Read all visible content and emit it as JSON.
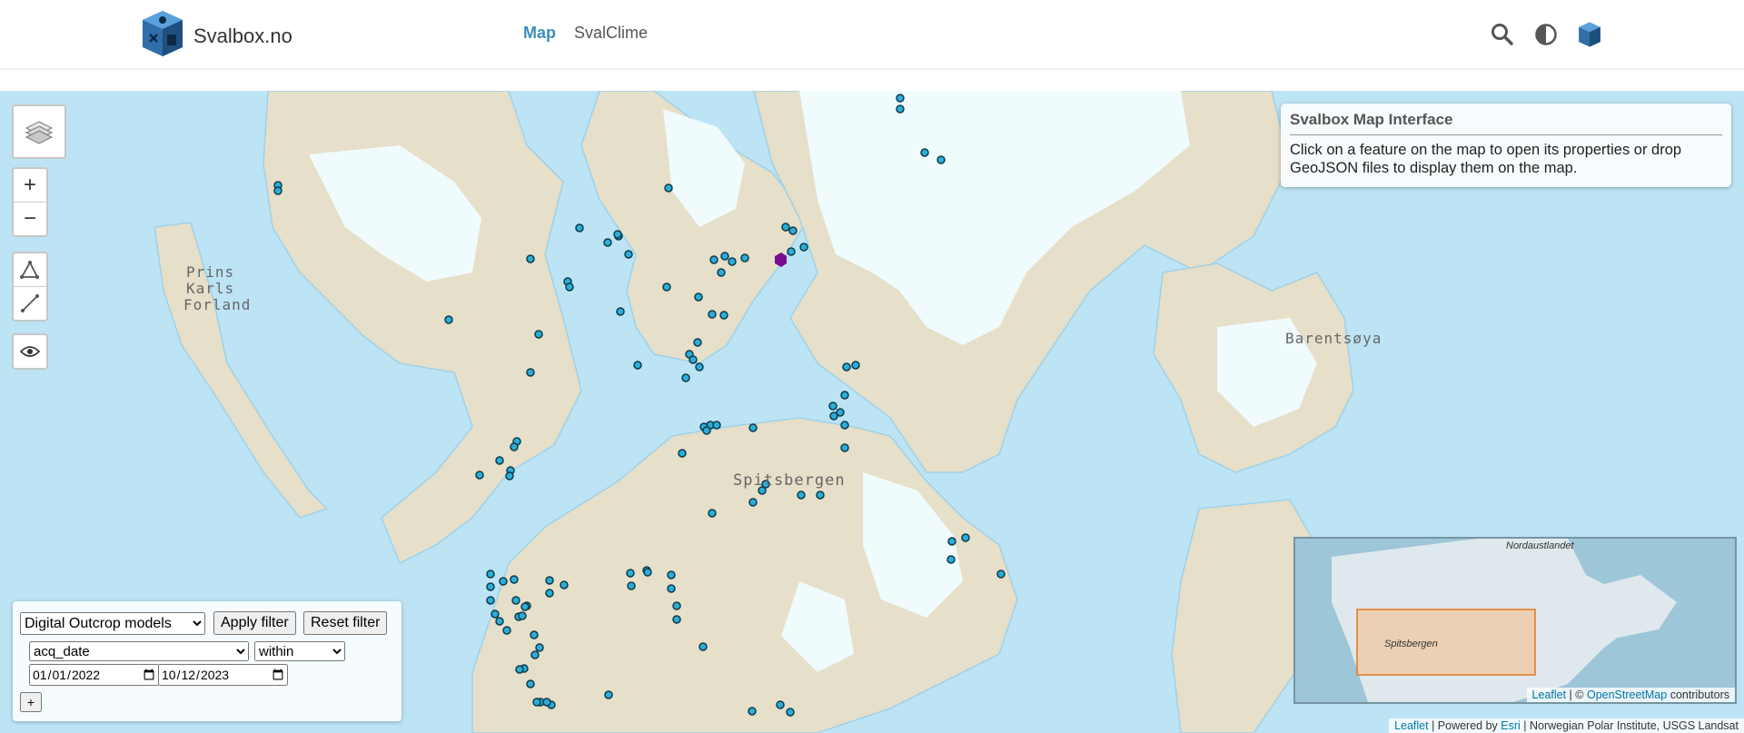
{
  "header": {
    "brand_text": "Svalbox.no",
    "nav": [
      {
        "label": "Map",
        "active": true
      },
      {
        "label": "SvalClime",
        "active": false
      }
    ],
    "icons": [
      "search-icon",
      "contrast-icon",
      "svalbox-logo-icon"
    ]
  },
  "map": {
    "place_labels": {
      "prins": "Prins",
      "karls": "Karls",
      "forland": "Forland",
      "barentsoya": "Barentsøya",
      "spitsbergen": "Spitsbergen"
    },
    "controls": [
      "layers-icon",
      "zoom-in-button",
      "zoom-out-button",
      "draw-polygon-icon",
      "draw-line-icon",
      "visibility-icon"
    ],
    "zoom_in_label": "+",
    "zoom_out_label": "−",
    "colors": {
      "sea": "#bde4f5",
      "land": "#e6dfc9",
      "glacier": "#f0fbfd",
      "point": "#2aaed9",
      "selected": "#7b0b8f"
    }
  },
  "info_panel": {
    "title": "Svalbox Map Interface",
    "text": "Click on a feature on the map to open its properties or drop GeoJSON files to display them on the map."
  },
  "filter": {
    "layer_select": "Digital Outcrop models",
    "apply_label": "Apply filter",
    "reset_label": "Reset filter",
    "field_select": "acq_date",
    "operator_select": "within",
    "date_from": "2022-01-01",
    "date_to": "2023-10-12",
    "add_label": "+"
  },
  "minimap": {
    "label_north": "Nordaustlandet",
    "label_spitsbergen": "Spitsbergen",
    "attribution_leaflet": "Leaflet",
    "attribution_sep": " | © ",
    "attribution_osm": "OpenStreetMap",
    "attribution_tail": " contributors"
  },
  "attribution": {
    "leaflet": "Leaflet",
    "powered": " | Powered by ",
    "esri": "Esri",
    "tail": " | Norwegian Polar Institute, USGS Landsat"
  }
}
